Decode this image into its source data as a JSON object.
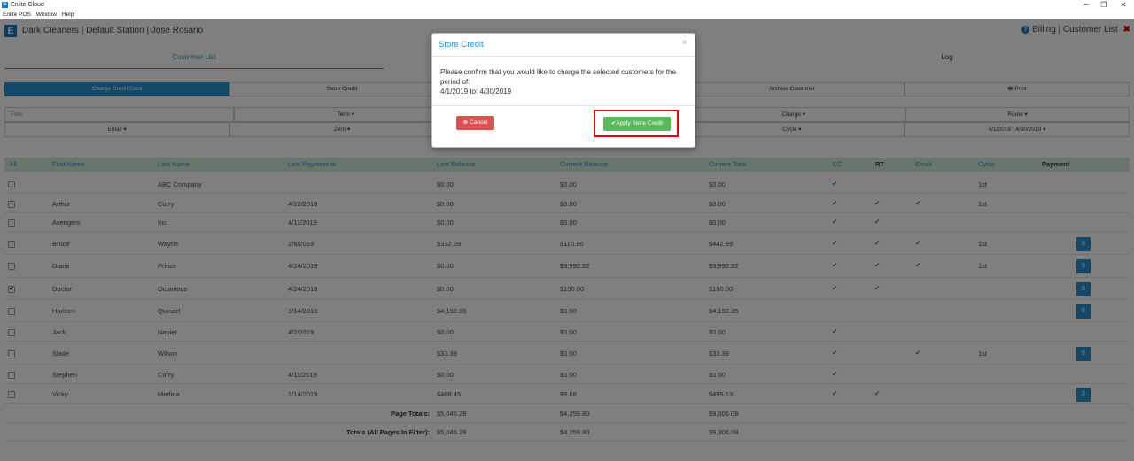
{
  "window": {
    "title": "Enlite Cloud",
    "menu": [
      "Enlite POS",
      "Window",
      "Help"
    ],
    "minimize": "─",
    "maximize": "❐",
    "close": "✕"
  },
  "header": {
    "app_name": "Dark Cleaners | Default Station | Jose Rosario",
    "right_links": "Billing | Customer List"
  },
  "tabs": [
    {
      "label": "Customer List"
    },
    {
      "label": "Log"
    }
  ],
  "actions": [
    {
      "label": "Charge Credit Card"
    },
    {
      "label": "Store Credit"
    },
    {
      "label": ""
    },
    {
      "label": "Archive Customer"
    },
    {
      "label": "Print"
    }
  ],
  "filters_row1": [
    "Filter",
    "Term ▾",
    "",
    "Charge ▾",
    "Route ▾"
  ],
  "filters_row2": [
    "Email ▾",
    "Zero ▾",
    "",
    "Cycle ▾",
    "4/1/2019 : 4/30/2019 ▾"
  ],
  "table": {
    "headers": [
      "-All",
      "First Name",
      "Last Name",
      "Last Payment at",
      "Last Balance",
      "Current Balance",
      "Current Total",
      "CC",
      "RT",
      "Email",
      "Cycle",
      "Payment"
    ],
    "rows": [
      {
        "checked": false,
        "first": "",
        "last": "ABC Company",
        "last_payment": "",
        "last_balance": "$0.00",
        "current_balance": "$0.00",
        "current_total": "$0.00",
        "cc": true,
        "rt": false,
        "email": false,
        "cycle": "1st",
        "pay": false
      },
      {
        "checked": false,
        "first": "Arthur",
        "last": "Curry",
        "last_payment": "4/22/2019",
        "last_balance": "$0.00",
        "current_balance": "$0.00",
        "current_total": "$0.00",
        "cc": true,
        "rt": true,
        "email": true,
        "cycle": "1st",
        "pay": false
      },
      {
        "checked": false,
        "first": "Avengers",
        "last": "Inc.",
        "last_payment": "4/11/2019",
        "last_balance": "$0.00",
        "current_balance": "$0.00",
        "current_total": "$0.00",
        "cc": true,
        "rt": true,
        "email": false,
        "cycle": "",
        "pay": false
      },
      {
        "checked": false,
        "first": "Bruce",
        "last": "Wayne",
        "last_payment": "2/8/2019",
        "last_balance": "$332.09",
        "current_balance": "$110.90",
        "current_total": "$442.99",
        "cc": true,
        "rt": true,
        "email": true,
        "cycle": "1st",
        "pay": true
      },
      {
        "checked": false,
        "first": "Diane",
        "last": "Prince",
        "last_payment": "4/24/2019",
        "last_balance": "$0.00",
        "current_balance": "$3,992.22",
        "current_total": "$3,992.22",
        "cc": true,
        "rt": true,
        "email": true,
        "cycle": "1st",
        "pay": true
      },
      {
        "checked": true,
        "first": "Doctor",
        "last": "Octavious",
        "last_payment": "4/24/2019",
        "last_balance": "$0.00",
        "current_balance": "$150.00",
        "current_total": "$150.00",
        "cc": true,
        "rt": true,
        "email": false,
        "cycle": "",
        "pay": true
      },
      {
        "checked": false,
        "first": "Harleen",
        "last": "Quinzel",
        "last_payment": "3/14/2019",
        "last_balance": "$4,192.35",
        "current_balance": "$0.00",
        "current_total": "$4,192.35",
        "cc": false,
        "rt": false,
        "email": false,
        "cycle": "",
        "pay": true
      },
      {
        "checked": false,
        "first": "Jack",
        "last": "Napier",
        "last_payment": "4/2/2019",
        "last_balance": "$0.00",
        "current_balance": "$0.00",
        "current_total": "$0.00",
        "cc": true,
        "rt": false,
        "email": false,
        "cycle": "",
        "pay": false
      },
      {
        "checked": false,
        "first": "Slade",
        "last": "Wilson",
        "last_payment": "",
        "last_balance": "$33.39",
        "current_balance": "$0.00",
        "current_total": "$33.39",
        "cc": true,
        "rt": false,
        "email": true,
        "cycle": "1st",
        "pay": true
      },
      {
        "checked": false,
        "first": "Stephen",
        "last": "Curry",
        "last_payment": "4/11/2019",
        "last_balance": "$0.00",
        "current_balance": "$0.00",
        "current_total": "$0.00",
        "cc": true,
        "rt": false,
        "email": false,
        "cycle": "",
        "pay": false
      },
      {
        "checked": false,
        "first": "Vicky",
        "last": "Medina",
        "last_payment": "3/14/2019",
        "last_balance": "$488.45",
        "current_balance": "$6.68",
        "current_total": "$495.13",
        "cc": true,
        "rt": true,
        "email": false,
        "cycle": "",
        "pay": true
      }
    ],
    "page_totals": {
      "label": "Page Totals:",
      "last_balance": "$5,046.28",
      "current_balance": "$4,259.80",
      "current_total": "$9,306.08"
    },
    "all_totals": {
      "label": "Totals (All Pages In Filter):",
      "last_balance": "$5,046.28",
      "current_balance": "$4,259.80",
      "current_total": "$9,306.08"
    },
    "check_glyph": "✔",
    "pay_glyph": "$"
  },
  "modal": {
    "title": "Store Credit",
    "close": "×",
    "message": "Please confirm that you would like to charge the selected customers for the period of:",
    "period": "4/1/2019 to: 4/30/2019",
    "cancel_label": "Cancel",
    "apply_label": "Apply Store Credit"
  },
  "colors": {
    "accent": "#2a8fd0",
    "header_row": "#d5ecd6",
    "cancel": "#d9534f",
    "apply": "#5cb85c",
    "highlight": "#ee0000"
  }
}
